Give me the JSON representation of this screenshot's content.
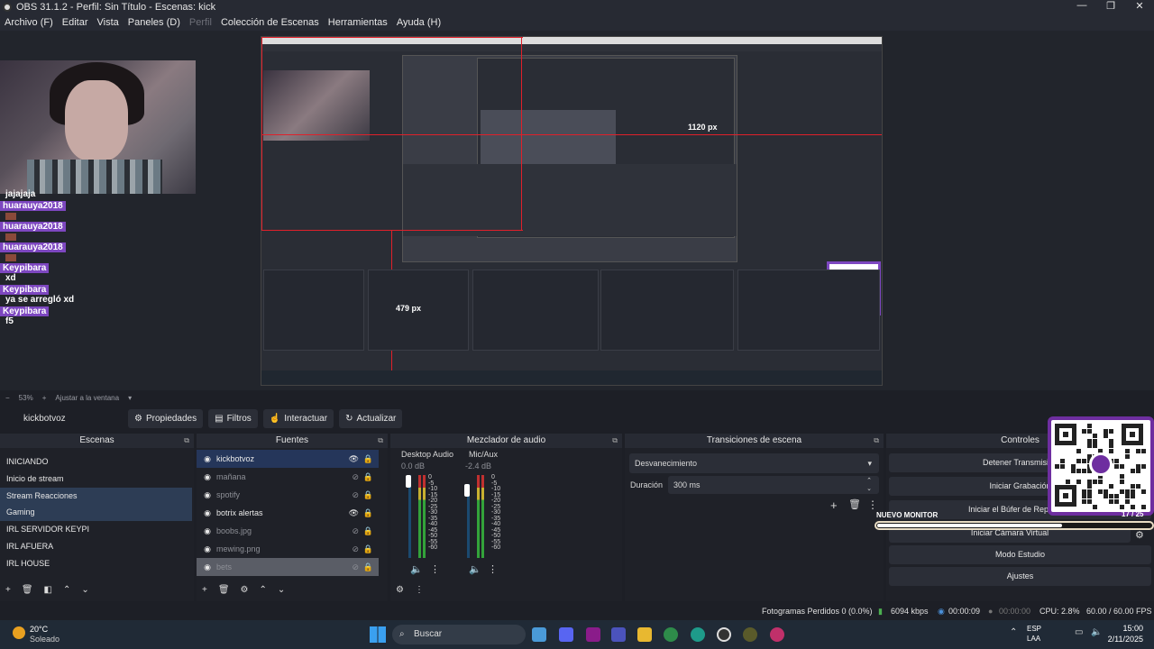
{
  "window": {
    "title": "OBS 31.1.2 - Perfil: Sin Título - Escenas: kick"
  },
  "menu": [
    "Archivo (F)",
    "Editar",
    "Vista",
    "Paneles (D)",
    "Perfil",
    "Colección de Escenas",
    "Herramientas",
    "Ayuda (H)"
  ],
  "preview": {
    "chat": [
      {
        "type": "text",
        "text": "jajajaja"
      },
      {
        "type": "name",
        "text": "huarauya2018"
      },
      {
        "type": "emote"
      },
      {
        "type": "name",
        "text": "huarauya2018"
      },
      {
        "type": "emote"
      },
      {
        "type": "name",
        "text": "huarauya2018"
      },
      {
        "type": "emote"
      },
      {
        "type": "name",
        "text": "Keypibara"
      },
      {
        "type": "text",
        "text": "xd"
      },
      {
        "type": "name",
        "text": "Keypibara"
      },
      {
        "type": "text",
        "text": "ya se arregló xd"
      },
      {
        "type": "name",
        "text": "Keypibara"
      },
      {
        "type": "text",
        "text": "f5"
      }
    ],
    "label_1120": "1120 px",
    "label_479": "479 px"
  },
  "zoom": {
    "value": "53%",
    "fit_label": "Ajustar a la ventana"
  },
  "source_toolbar": {
    "name": "kickbotvoz",
    "properties": "Propiedades",
    "filters": "Filtros",
    "interact": "Interactuar",
    "refresh": "Actualizar"
  },
  "scenes": {
    "title": "Escenas",
    "items": [
      "INICIANDO",
      "Inicio de stream",
      "Stream Reacciones",
      "Gaming",
      "IRL SERVIDOR KEYPI",
      "IRL AFUERA",
      "IRL HOUSE"
    ],
    "selected": "Stream Reacciones"
  },
  "sources": {
    "title": "Fuentes",
    "items": [
      {
        "label": "kickbotvoz",
        "visible": true,
        "selected": true
      },
      {
        "label": "mañana",
        "visible": false
      },
      {
        "label": "spotify",
        "visible": false
      },
      {
        "label": "botrix alertas",
        "visible": true
      },
      {
        "label": "boobs.jpg",
        "visible": false
      },
      {
        "label": "mewing.png",
        "visible": false
      },
      {
        "label": "bets",
        "visible": false
      }
    ]
  },
  "mixer": {
    "title": "Mezclador de audio",
    "channels": [
      {
        "name": "Desktop Audio",
        "db": "0.0 dB"
      },
      {
        "name": "Mic/Aux",
        "db": "-2.4 dB"
      }
    ],
    "scale": [
      "0",
      "-5",
      "-10",
      "-15",
      "-20",
      "-25",
      "-30",
      "-35",
      "-40",
      "-45",
      "-50",
      "-55",
      "-60"
    ]
  },
  "transitions": {
    "title": "Transiciones de escena",
    "selected": "Desvanecimiento",
    "duration_label": "Duración",
    "duration_value": "300 ms"
  },
  "controls": {
    "title": "Controles",
    "stop_stream": "Detener Transmisión",
    "start_recording": "Iniciar Grabación",
    "replay_buffer": "Iniciar el Búfer de Repetición",
    "virtual_camera": "Iniciar Cámara Virtual",
    "studio_mode": "Modo Estudio",
    "settings": "Ajustes"
  },
  "overlay": {
    "monitor_label": "NUEVO MONITOR",
    "qr_counter": "17 / 25",
    "progress": 0.67
  },
  "status": {
    "dropped": "Fotogramas Perdidos 0 (0.0%)",
    "bitrate": "6094 kbps",
    "stream_time": "00:00:09",
    "rec_time": "00:00:00",
    "cpu": "CPU: 2.8%",
    "fps": "60.00 / 60.00 FPS"
  },
  "taskbar": {
    "weather_temp": "20°C",
    "weather_desc": "Soleado",
    "search": "Buscar",
    "lang1": "ESP",
    "lang2": "LAA",
    "time": "15:00",
    "date": "2/11/2025"
  }
}
